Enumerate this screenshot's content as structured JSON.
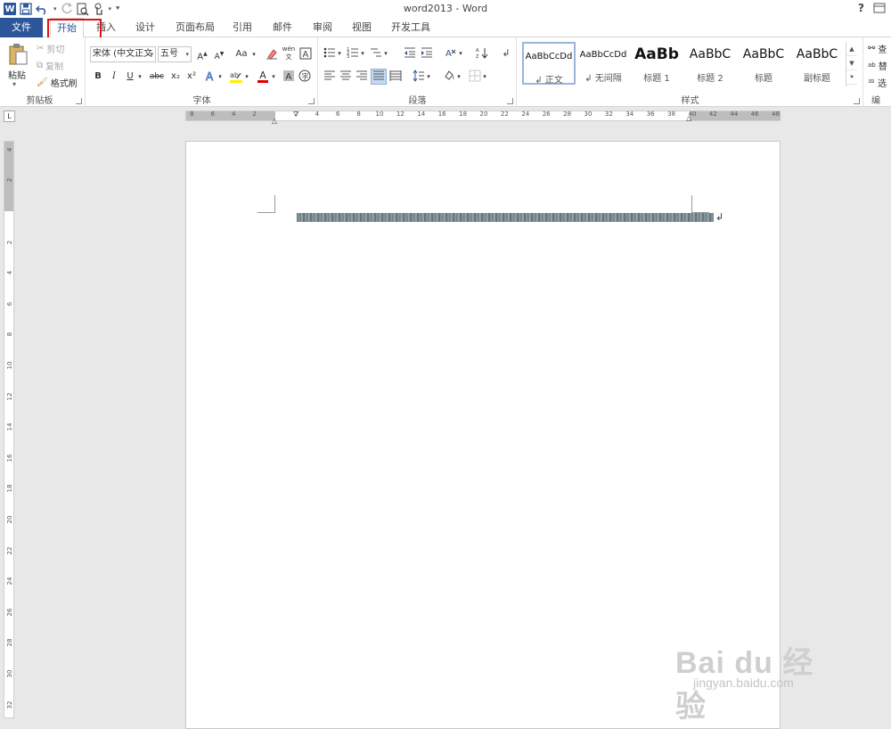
{
  "window": {
    "title": "word2013 - Word",
    "help": "?"
  },
  "qat": {
    "app_icon": "W",
    "icons": [
      "save-icon",
      "undo-icon",
      "redo-icon",
      "print-preview-icon",
      "touch-mode-icon",
      "customize-qat-icon"
    ]
  },
  "tabs": [
    {
      "label": "文件"
    },
    {
      "label": "开始"
    },
    {
      "label": "插入"
    },
    {
      "label": "设计"
    },
    {
      "label": "页面布局"
    },
    {
      "label": "引用"
    },
    {
      "label": "邮件"
    },
    {
      "label": "审阅"
    },
    {
      "label": "视图"
    },
    {
      "label": "开发工具"
    }
  ],
  "active_tab": "开始",
  "clipboard": {
    "paste": "粘贴",
    "cut": "剪切",
    "copy": "复制",
    "format_painter": "格式刷",
    "label": "剪贴板"
  },
  "font": {
    "font_name": "宋体 (中文正文",
    "font_size": "五号",
    "change_case": "Aa",
    "phonetic": "wén 文",
    "bold": "B",
    "italic": "I",
    "underline": "U",
    "strike": "abc",
    "subscript": "x₂",
    "superscript": "x²",
    "font_color_glyph": "A",
    "label": "字体"
  },
  "paragraph": {
    "label": "段落"
  },
  "styles": {
    "label": "样式",
    "items": [
      {
        "sample": "AaBbCcDd",
        "name": "↲ 正文",
        "selected": true
      },
      {
        "sample": "AaBbCcDd",
        "name": "↲ 无间隔",
        "selected": false
      },
      {
        "sample": "AaBb",
        "name": "标题 1",
        "selected": false
      },
      {
        "sample": "AaBbC",
        "name": "标题 2",
        "selected": false
      },
      {
        "sample": "AaBbC",
        "name": "标题",
        "selected": false
      },
      {
        "sample": "AaBbC",
        "name": "副标题",
        "selected": false
      }
    ]
  },
  "editing": {
    "find": "查",
    "replace": "替",
    "select": "选",
    "label": "编"
  },
  "ruler": {
    "corner": "L",
    "h_left": [
      "8",
      "6",
      "4",
      "2"
    ],
    "h_right": [
      "2",
      "4",
      "6",
      "8",
      "10",
      "12",
      "14",
      "16",
      "18",
      "20",
      "22",
      "24",
      "26",
      "28",
      "30",
      "32",
      "34",
      "36",
      "38",
      "40",
      "42",
      "44",
      "46",
      "48"
    ],
    "v_top": [
      "4",
      "2"
    ],
    "v_body": [
      "2",
      "4",
      "6",
      "8",
      "10",
      "12",
      "14",
      "16",
      "18",
      "20",
      "22",
      "24",
      "26",
      "28",
      "30",
      "32"
    ]
  },
  "document": {
    "paragraph_mark": "↲"
  },
  "watermark": {
    "brand": "Bai du 经验",
    "url": "jingyan.baidu.com"
  },
  "colors": {
    "accent": "#2b579a",
    "highlight_box": "#e01010"
  }
}
